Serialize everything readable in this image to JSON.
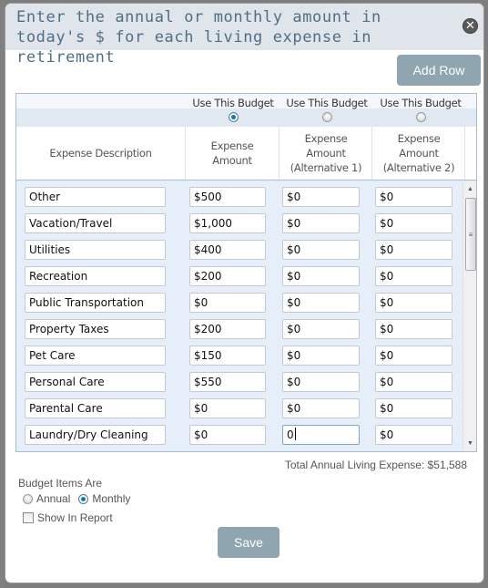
{
  "dialog": {
    "title": "Enter the annual or monthly amount in today's $ for each living expense in retirement",
    "close_icon": "close-icon",
    "add_row_label": "Add Row"
  },
  "table": {
    "use_budget_label": "Use This Budget",
    "selected_budget_index": 0,
    "columns": [
      "Expense Description",
      "Expense Amount",
      "Expense Amount (Alternative 1)",
      "Expense Amount (Alternative 2)"
    ],
    "column_lines": [
      [
        "Expense Description"
      ],
      [
        "Expense",
        "Amount"
      ],
      [
        "Expense",
        "Amount",
        "(Alternative 1)"
      ],
      [
        "Expense",
        "Amount",
        "(Alternative 2)"
      ]
    ],
    "rows": [
      {
        "description": "Other",
        "amount": "$500",
        "alt1": "$0",
        "alt2": "$0"
      },
      {
        "description": "Vacation/Travel",
        "amount": "$1,000",
        "alt1": "$0",
        "alt2": "$0"
      },
      {
        "description": "Utilities",
        "amount": "$400",
        "alt1": "$0",
        "alt2": "$0"
      },
      {
        "description": "Recreation",
        "amount": "$200",
        "alt1": "$0",
        "alt2": "$0"
      },
      {
        "description": "Public Transportation",
        "amount": "$0",
        "alt1": "$0",
        "alt2": "$0"
      },
      {
        "description": "Property Taxes",
        "amount": "$200",
        "alt1": "$0",
        "alt2": "$0"
      },
      {
        "description": "Pet Care",
        "amount": "$150",
        "alt1": "$0",
        "alt2": "$0"
      },
      {
        "description": "Personal Care",
        "amount": "$550",
        "alt1": "$0",
        "alt2": "$0"
      },
      {
        "description": "Parental Care",
        "amount": "$0",
        "alt1": "$0",
        "alt2": "$0"
      },
      {
        "description": "Laundry/Dry Cleaning",
        "amount": "$0",
        "alt1": "0",
        "alt2": "$0"
      },
      {
        "description": "",
        "amount": "",
        "alt1": "",
        "alt2": ""
      }
    ],
    "focused_cell": {
      "row": 9,
      "column": "alt1"
    }
  },
  "footer": {
    "total_label": "Total Annual Living Expense: $51,588",
    "budget_items_label": "Budget Items Are",
    "period_options": [
      "Annual",
      "Monthly"
    ],
    "period_selected": "Monthly",
    "show_in_report_label": "Show In Report",
    "show_in_report_checked": false,
    "save_label": "Save"
  },
  "colors": {
    "header_bg": "#dfe5ea",
    "title_text": "#4f6f85",
    "button_bg": "#8fa5b0",
    "table_bg": "#e6eef9",
    "overlay": "#7d7d7d"
  }
}
